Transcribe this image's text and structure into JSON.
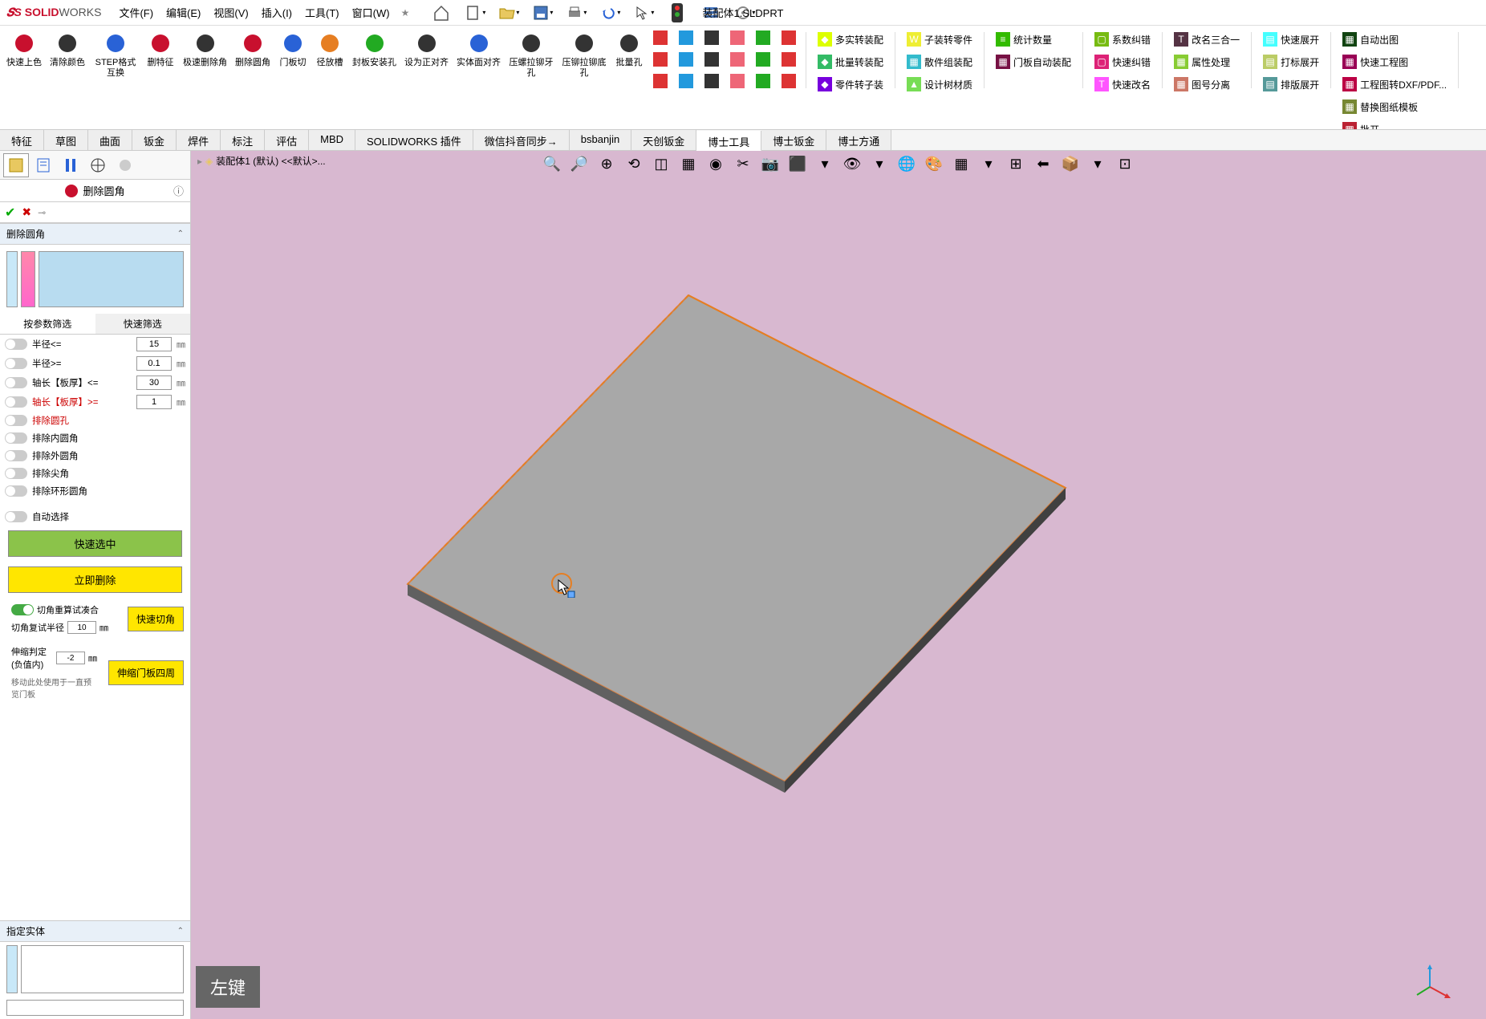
{
  "app": {
    "brand_prefix": "SOLID",
    "brand_suffix": "WORKS",
    "doc_title": "装配体1.SLDPRT"
  },
  "menu": [
    "文件(F)",
    "编辑(E)",
    "视图(V)",
    "插入(I)",
    "工具(T)",
    "窗口(W)"
  ],
  "ribbon_large": [
    {
      "label": "快速上色",
      "color": "#c8102e"
    },
    {
      "label": "清除颜色",
      "color": "#333"
    },
    {
      "label": "STEP格式互换",
      "color": "#2962d6"
    },
    {
      "label": "删特征",
      "color": "#c8102e"
    },
    {
      "label": "极速删除角",
      "color": "#333"
    },
    {
      "label": "删除圆角",
      "color": "#c8102e"
    },
    {
      "label": "门板切",
      "color": "#2962d6"
    },
    {
      "label": "径放槽",
      "color": "#e67e22"
    },
    {
      "label": "封板安装孔",
      "color": "#2a2"
    },
    {
      "label": "设为正对齐",
      "color": "#333"
    },
    {
      "label": "实体面对齐",
      "color": "#2962d6"
    },
    {
      "label": "压螺拉铆牙孔",
      "color": "#333"
    },
    {
      "label": "压铆拉铆底孔",
      "color": "#333"
    },
    {
      "label": "批量孔",
      "color": "#333"
    }
  ],
  "ribbon_groups": [
    [
      {
        "label": "多实转装配",
        "ic": "◆"
      },
      {
        "label": "批量转装配",
        "ic": "◆"
      },
      {
        "label": "零件转子装",
        "ic": "◆"
      }
    ],
    [
      {
        "label": "子装转零件",
        "ic": "W"
      },
      {
        "label": "散件组装配",
        "ic": "▦"
      },
      {
        "label": "设计树材质",
        "ic": "▲"
      }
    ],
    [
      {
        "label": "统计数量",
        "ic": "≡"
      },
      {
        "label": "门板自动装配",
        "ic": "▦"
      }
    ],
    [
      {
        "label": "系数纠错",
        "ic": "▢"
      },
      {
        "label": "快速纠错",
        "ic": "▢"
      },
      {
        "label": "快速改名",
        "ic": "T"
      }
    ],
    [
      {
        "label": "改名三合一",
        "ic": "T"
      },
      {
        "label": "属性处理",
        "ic": "▦"
      },
      {
        "label": "图号分离",
        "ic": "▦"
      }
    ],
    [
      {
        "label": "快速展开",
        "ic": "▤"
      },
      {
        "label": "打标展开",
        "ic": "▤"
      },
      {
        "label": "排版展开",
        "ic": "▤"
      }
    ],
    [
      {
        "label": "自动出图",
        "ic": "▦"
      },
      {
        "label": "快速工程图",
        "ic": "▦"
      },
      {
        "label": "工程图转DXF/PDF...",
        "ic": "▦"
      },
      {
        "label": "替换图纸模板",
        "ic": "▦"
      },
      {
        "label": "批开",
        "ic": "▦"
      }
    ]
  ],
  "tabs": [
    "特征",
    "草图",
    "曲面",
    "钣金",
    "焊件",
    "标注",
    "评估",
    "MBD",
    "SOLIDWORKS 插件",
    "微信抖音同步→",
    "bsbanjin",
    "天创钣金",
    "博士工具",
    "博士钣金",
    "博士方通"
  ],
  "active_tab": 12,
  "prop": {
    "title": "删除圆角",
    "section1": "删除圆角",
    "filter_tabs": [
      "按参数筛选",
      "快速筛选"
    ],
    "params": [
      {
        "label": "半径<=",
        "value": "15",
        "unit": "㎜",
        "on": false,
        "red": false
      },
      {
        "label": "半径>=",
        "value": "0.1",
        "unit": "㎜",
        "on": false,
        "red": false
      },
      {
        "label": "轴长【板厚】<=",
        "value": "30",
        "unit": "㎜",
        "on": false,
        "red": false
      },
      {
        "label": "轴长【板厚】>=",
        "value": "1",
        "unit": "㎜",
        "on": false,
        "red": true
      },
      {
        "label": "排除圆孔",
        "value": "",
        "unit": "",
        "on": false,
        "red": true
      },
      {
        "label": "排除内圆角",
        "value": "",
        "unit": "",
        "on": false,
        "red": false
      },
      {
        "label": "排除外圆角",
        "value": "",
        "unit": "",
        "on": false,
        "red": false
      },
      {
        "label": "排除尖角",
        "value": "",
        "unit": "",
        "on": false,
        "red": false
      },
      {
        "label": "排除环形圆角",
        "value": "",
        "unit": "",
        "on": false,
        "red": false
      }
    ],
    "auto_select": "自动选择",
    "btn_quick_select": "快速选中",
    "btn_delete_now": "立即删除",
    "opt_toggle_label": "切角重算试凑合",
    "opt_small_label": "切角复试半径",
    "opt_small_value": "10",
    "btn_quick_chamfer": "快速切角",
    "opt_ext_label": "伸缩判定(负值内)",
    "opt_ext_value": "-2",
    "opt_ext_hint": "移动此处使用于一直预览门板",
    "btn_shrink_door": "伸缩门板四周",
    "section2": "指定实体"
  },
  "breadcrumb": "装配体1 (默认) <<默认>...",
  "key_overlay": "左键"
}
